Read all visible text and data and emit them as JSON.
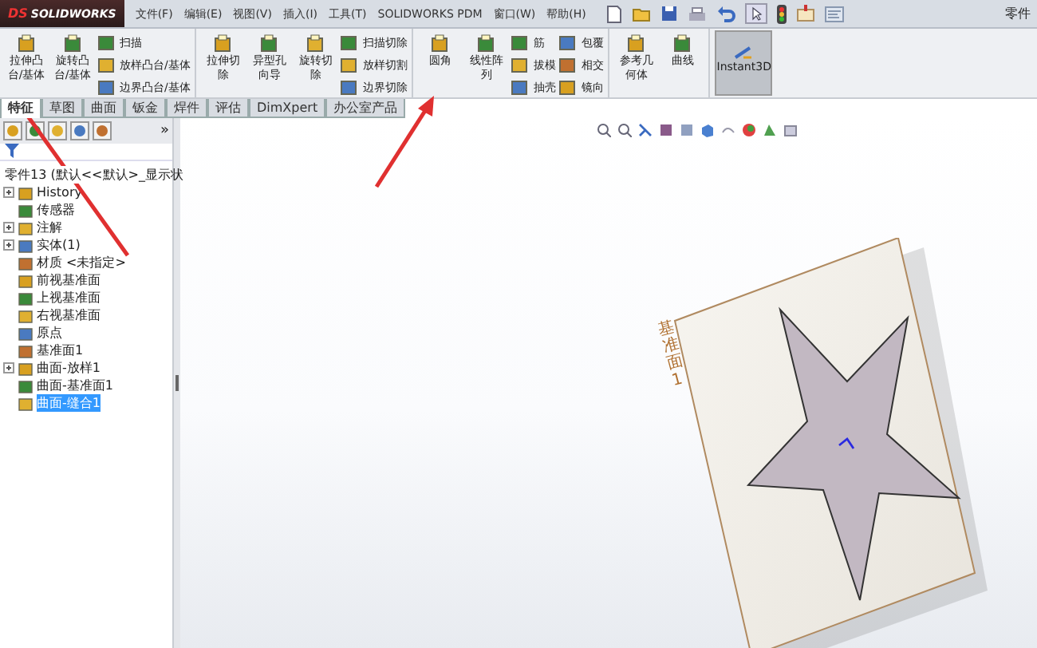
{
  "app": {
    "logo_mark": "DS",
    "logo": "SOLIDWORKS",
    "title": "零件"
  },
  "menu": [
    "文件(F)",
    "编辑(E)",
    "视图(V)",
    "插入(I)",
    "工具(T)",
    "SOLIDWORKS PDM",
    "窗口(W)",
    "帮助(H)"
  ],
  "ribbon": [
    {
      "large": [
        "拉伸凸台/基体",
        "旋转凸台/基体"
      ],
      "small": [
        [
          "扫描",
          "放样凸台/基体",
          "边界凸台/基体"
        ]
      ]
    },
    {
      "large": [
        "拉伸切除",
        "异型孔向导",
        "旋转切除"
      ],
      "small": [
        [
          "扫描切除",
          "放样切割",
          "边界切除"
        ]
      ]
    },
    {
      "large": [
        "圆角",
        "线性阵列"
      ],
      "small": [
        [
          "筋",
          "拔模",
          "抽壳"
        ],
        [
          "包覆",
          "相交",
          "镜向"
        ]
      ]
    },
    {
      "large": [
        "参考几何体",
        "曲线"
      ]
    }
  ],
  "instant3d": {
    "label": "Instant3D",
    "selected": true
  },
  "tabs": [
    {
      "label": "特征",
      "selected": true
    },
    {
      "label": "草图",
      "selected": false
    },
    {
      "label": "曲面",
      "selected": false
    },
    {
      "label": "钣金",
      "selected": false
    },
    {
      "label": "焊件",
      "selected": false
    },
    {
      "label": "评估",
      "selected": false
    },
    {
      "label": "DimXpert",
      "selected": false
    },
    {
      "label": "办公室产品",
      "selected": false
    }
  ],
  "panel_more": "»",
  "tree": {
    "root": "零件13 (默认<<默认>_显示状",
    "items": [
      {
        "label": "History",
        "kind": "collapsed",
        "selected": false
      },
      {
        "label": "传感器",
        "kind": "leaf",
        "selected": false
      },
      {
        "label": "注解",
        "kind": "collapsed",
        "selected": false
      },
      {
        "label": "实体(1)",
        "kind": "collapsed",
        "selected": false
      },
      {
        "label": "材质 <未指定>",
        "kind": "leaf",
        "selected": false
      },
      {
        "label": "前视基准面",
        "kind": "leaf",
        "selected": false
      },
      {
        "label": "上视基准面",
        "kind": "leaf",
        "selected": false
      },
      {
        "label": "右视基准面",
        "kind": "leaf",
        "selected": false
      },
      {
        "label": "原点",
        "kind": "leaf",
        "selected": false
      },
      {
        "label": "基准面1",
        "kind": "leaf",
        "selected": false
      },
      {
        "label": "曲面-放样1",
        "kind": "collapsed",
        "selected": false
      },
      {
        "label": "曲面-基准面1",
        "kind": "leaf",
        "selected": false
      },
      {
        "label": "曲面-缝合1",
        "kind": "leaf",
        "selected": true
      }
    ]
  },
  "canvas": {
    "plane_label": "基准面1"
  }
}
